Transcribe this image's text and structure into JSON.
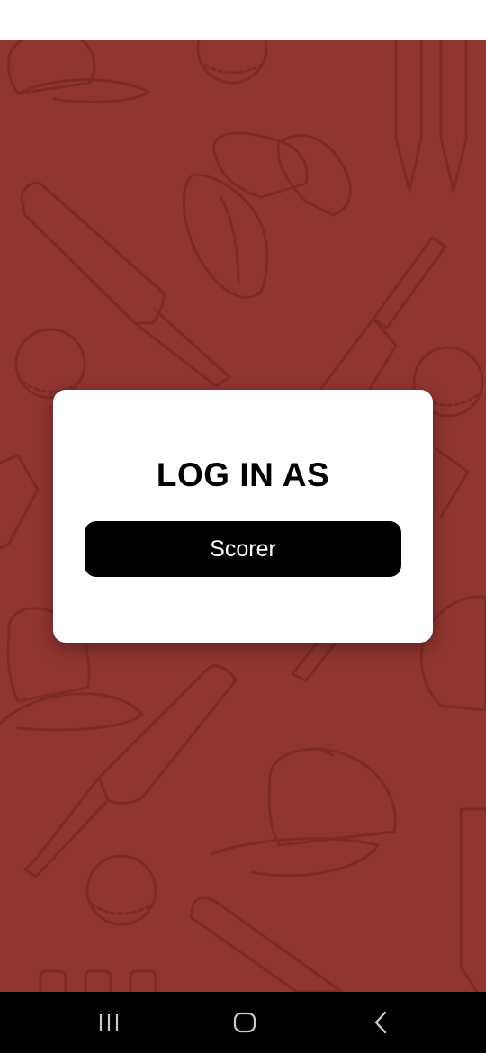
{
  "dialog": {
    "title": "LOG IN AS",
    "scorer_label": "Scorer"
  },
  "colors": {
    "background": "#913531",
    "pattern_stroke": "#7e2b28",
    "dialog_bg": "#ffffff",
    "button_bg": "#000000",
    "button_text": "#ffffff",
    "nav_bar": "#000000"
  },
  "navigation": {
    "buttons": [
      "recent-apps-icon",
      "home-icon",
      "back-icon"
    ]
  },
  "background_pattern": [
    "cricket-bat-icon",
    "cricket-ball-icon",
    "cricket-cap-icon",
    "cricket-glove-icon",
    "cricket-stumps-icon"
  ]
}
